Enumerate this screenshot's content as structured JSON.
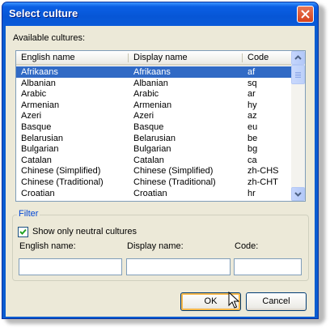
{
  "window": {
    "title": "Select culture"
  },
  "available_label": "Available cultures:",
  "columns": [
    "English name",
    "Display name",
    "Code"
  ],
  "rows": [
    {
      "english": "Afrikaans",
      "display": "Afrikaans",
      "code": "af",
      "selected": true
    },
    {
      "english": "Albanian",
      "display": "Albanian",
      "code": "sq"
    },
    {
      "english": "Arabic",
      "display": "Arabic",
      "code": "ar"
    },
    {
      "english": "Armenian",
      "display": "Armenian",
      "code": "hy"
    },
    {
      "english": "Azeri",
      "display": "Azeri",
      "code": "az"
    },
    {
      "english": "Basque",
      "display": "Basque",
      "code": "eu"
    },
    {
      "english": "Belarusian",
      "display": "Belarusian",
      "code": "be"
    },
    {
      "english": "Bulgarian",
      "display": "Bulgarian",
      "code": "bg"
    },
    {
      "english": "Catalan",
      "display": "Catalan",
      "code": "ca"
    },
    {
      "english": "Chinese (Simplified)",
      "display": "Chinese (Simplified)",
      "code": "zh-CHS"
    },
    {
      "english": "Chinese (Traditional)",
      "display": "Chinese (Traditional)",
      "code": "zh-CHT"
    },
    {
      "english": "Croatian",
      "display": "Croatian",
      "code": "hr"
    }
  ],
  "filter": {
    "title": "Filter",
    "neutral_label": "Show only neutral cultures",
    "neutral_checked": true,
    "english_label": "English name:",
    "display_label": "Display name:",
    "code_label": "Code:",
    "english_value": "",
    "display_value": "",
    "code_value": ""
  },
  "buttons": {
    "ok": "OK",
    "cancel": "Cancel"
  },
  "colors": {
    "titlebar": "#0a5cd0",
    "selection": "#316ac5",
    "face": "#ece9d8",
    "group_title": "#0046d5"
  }
}
